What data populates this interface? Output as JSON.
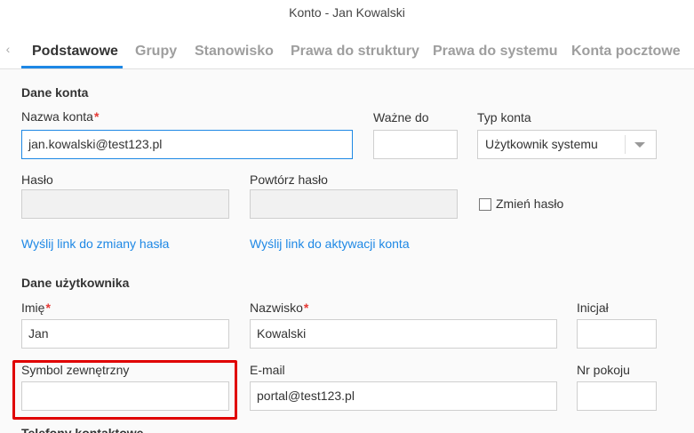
{
  "window": {
    "title": "Konto - Jan Kowalski"
  },
  "tabs": [
    {
      "label": "Podstawowe"
    },
    {
      "label": "Grupy"
    },
    {
      "label": "Stanowisko"
    },
    {
      "label": "Prawa do struktury"
    },
    {
      "label": "Prawa do systemu"
    },
    {
      "label": "Konta pocztowe"
    }
  ],
  "account": {
    "section_title": "Dane konta",
    "login_label": "Nazwa konta",
    "login_value": "jan.kowalski@test123.pl",
    "valid_to_label": "Ważne do",
    "valid_to_value": "",
    "account_type_label": "Typ konta",
    "account_type_value": "Użytkownik systemu",
    "password_label": "Hasło",
    "password_repeat_label": "Powtórz hasło",
    "change_password_label": "Zmień hasło",
    "change_password_checked": false,
    "send_reset_link": "Wyślij link do zmiany hasła",
    "send_activation_link": "Wyślij link do aktywacji konta"
  },
  "user": {
    "section_title": "Dane użytkownika",
    "first_name_label": "Imię",
    "first_name_value": "Jan",
    "last_name_label": "Nazwisko",
    "last_name_value": "Kowalski",
    "initial_label": "Inicjał",
    "initial_value": "",
    "external_symbol_label": "Symbol zewnętrzny",
    "external_symbol_value": "",
    "email_label": "E-mail",
    "email_value": "portal@test123.pl",
    "room_label": "Nr pokoju",
    "room_value": ""
  },
  "contact": {
    "section_title": "Telefony kontaktowe"
  },
  "colors": {
    "accent": "#1e88e5",
    "required": "#e53935",
    "highlight": "#e00000"
  }
}
